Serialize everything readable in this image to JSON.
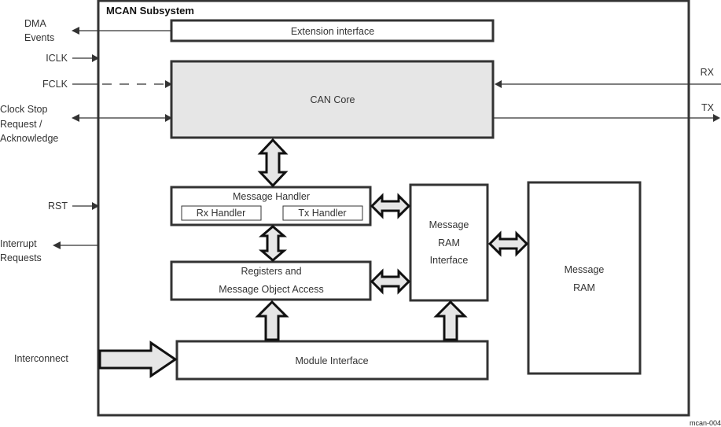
{
  "diagram": {
    "title": "MCAN Subsystem",
    "figure_id": "mcan-004",
    "blocks": {
      "extension_interface": "Extension interface",
      "can_core": "CAN Core",
      "message_handler": "Message Handler",
      "rx_handler": "Rx Handler",
      "tx_handler": "Tx Handler",
      "registers_line1": "Registers and",
      "registers_line2": "Message Object Access",
      "msg_ram_if_line1": "Message",
      "msg_ram_if_line2": "RAM",
      "msg_ram_if_line3": "Interface",
      "msg_ram_line1": "Message",
      "msg_ram_line2": "RAM",
      "module_interface": "Module Interface"
    },
    "signals": {
      "dma_line1": "DMA",
      "dma_line2": "Events",
      "iclk": "ICLK",
      "fclk": "FCLK",
      "clkstop_line1": "Clock Stop",
      "clkstop_line2": "Request /",
      "clkstop_line3": "Acknowledge",
      "rst": "RST",
      "irq_line1": "Interrupt",
      "irq_line2": "Requests",
      "interconnect": "Interconnect",
      "rx": "RX",
      "tx": "TX"
    },
    "colors": {
      "stroke": "#333333",
      "fill_gray": "#e6e6e6"
    }
  }
}
